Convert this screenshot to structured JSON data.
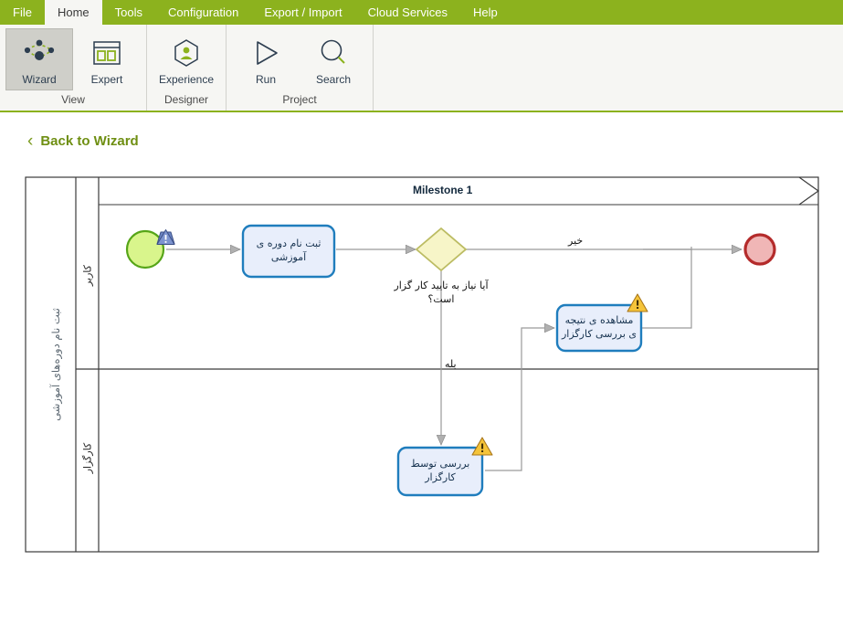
{
  "menu": {
    "items": [
      {
        "label": "File",
        "active": false
      },
      {
        "label": "Home",
        "active": true
      },
      {
        "label": "Tools",
        "active": false
      },
      {
        "label": "Configuration",
        "active": false
      },
      {
        "label": "Export / Import",
        "active": false
      },
      {
        "label": "Cloud Services",
        "active": false
      },
      {
        "label": "Help",
        "active": false
      }
    ]
  },
  "ribbon": {
    "groups": [
      {
        "label": "View",
        "items": [
          {
            "label": "Wizard",
            "icon": "wizard-nodes-icon",
            "selected": true
          },
          {
            "label": "Expert",
            "icon": "expert-window-icon",
            "selected": false
          }
        ]
      },
      {
        "label": "Designer",
        "items": [
          {
            "label": "Experience",
            "icon": "experience-person-hexagon-icon",
            "selected": false
          }
        ]
      },
      {
        "label": "Project",
        "items": [
          {
            "label": "Run",
            "icon": "run-play-icon",
            "selected": false
          },
          {
            "label": "Search",
            "icon": "search-magnifier-icon",
            "selected": false
          }
        ]
      }
    ]
  },
  "back_link": {
    "chevron": "‹",
    "label": "Back to Wizard"
  },
  "diagram": {
    "pool_label": "ثبت نام دوره‌های آموزشی",
    "lanes": [
      {
        "label": "کاربر"
      },
      {
        "label": "کارگزار"
      }
    ],
    "milestone": {
      "label": "Milestone 1"
    },
    "nodes": [
      {
        "id": "start",
        "type": "start-event",
        "label": "",
        "badge": "info-triangle-blue"
      },
      {
        "id": "task1",
        "type": "task",
        "label": "ثبت نام دوره ی آموزشی",
        "badge": null
      },
      {
        "id": "gateway",
        "type": "exclusive-gateway",
        "label": "آیا نیاز به تایید کار گزار است؟"
      },
      {
        "id": "task2",
        "type": "task",
        "label": "مشاهده ی نتیجه ی بررسی کارگزار",
        "badge": "warning-triangle-yellow"
      },
      {
        "id": "task3",
        "type": "task",
        "label": "بررسی توسط کارگزار",
        "badge": "warning-triangle-yellow"
      },
      {
        "id": "end",
        "type": "end-event",
        "label": "",
        "badge": null
      }
    ],
    "flow_labels": [
      {
        "id": "no",
        "label": "خیر"
      },
      {
        "id": "yes",
        "label": "بله"
      }
    ]
  },
  "colors": {
    "brand_green": "#8cb21e",
    "menu_active_bg": "#f6f6f3",
    "link_green": "#6f8f13",
    "start_fill": "#d9f58c",
    "start_stroke": "#56a518",
    "end_fill": "#f0b6b6",
    "end_stroke": "#b42b2b",
    "gateway_fill": "#f7f5c8",
    "gateway_stroke": "#bcbc63",
    "task_fill": "#e8eefb",
    "task_stroke": "#1f7dbd",
    "connector": "#9a9a9a",
    "warn_fill": "#f5c43a",
    "info_fill": "#6d86c4"
  }
}
